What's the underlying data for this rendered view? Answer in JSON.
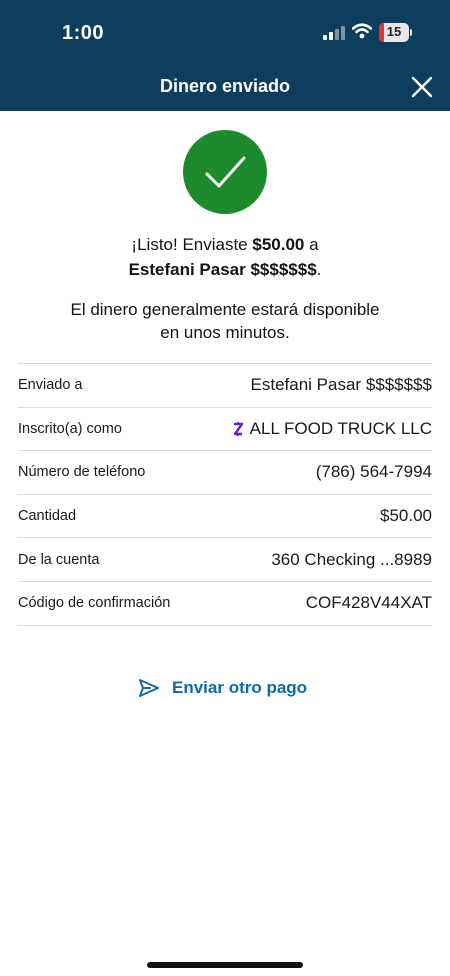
{
  "status_bar": {
    "time": "1:00",
    "battery_level": "15"
  },
  "header": {
    "title": "Dinero enviado",
    "close_icon": "close-icon"
  },
  "confirmation": {
    "line1_prefix": "¡Listo! Enviaste ",
    "amount": "$50.00",
    "line1_suffix": " a",
    "recipient": "Estefani Pasar $$$$$$$",
    "line2_suffix": ".",
    "availability_line1": "El dinero generalmente estará disponible",
    "availability_line2": "en unos minutos."
  },
  "details": [
    {
      "label": "Enviado a",
      "value": "Estefani Pasar $$$$$$$"
    },
    {
      "label": "Inscrito(a) como",
      "value": "ALL FOOD TRUCK LLC",
      "icon": "zelle-icon"
    },
    {
      "label": "Número de teléfono",
      "value": "(786) 564-7994"
    },
    {
      "label": "Cantidad",
      "value": "$50.00"
    },
    {
      "label": "De la cuenta",
      "value": "360 Checking ...8989"
    },
    {
      "label": "Código de confirmación",
      "value": "COF428V44XAT"
    }
  ],
  "actions": {
    "send_again_label": "Enviar otro pago",
    "send_again_icon": "send-icon"
  },
  "colors": {
    "header_bg": "#0f3d5e",
    "success_green": "#1d8a2e",
    "link_blue": "#0e6aa8",
    "zelle_purple": "#6d1ed4",
    "battery_red": "#e0342d"
  }
}
